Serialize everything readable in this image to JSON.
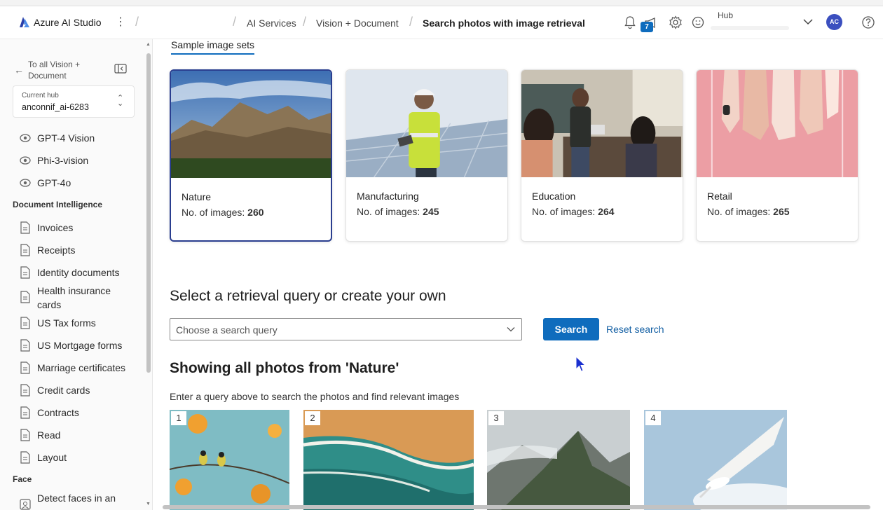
{
  "app": {
    "name": "Azure AI Studio"
  },
  "breadcrumb": [
    "AI Services",
    "Vision + Document",
    "Search photos with image retrieval"
  ],
  "header": {
    "notification_count": "7",
    "hub_label": "Hub",
    "avatar_initials": "AC"
  },
  "sidebar": {
    "back_label": "To all Vision + Document",
    "hub_card": {
      "label": "Current hub",
      "value": "anconnif_ai-6283"
    },
    "vision_items": [
      "GPT-4 Vision",
      "Phi-3-vision",
      "GPT-4o"
    ],
    "doc_section": "Document Intelligence",
    "doc_items": [
      "Invoices",
      "Receipts",
      "Identity documents",
      "Health insurance cards",
      "US Tax forms",
      "US Mortgage forms",
      "Marriage certificates",
      "Credit cards",
      "Contracts",
      "Read",
      "Layout"
    ],
    "face_section": "Face",
    "face_items": [
      "Detect faces in an"
    ]
  },
  "main": {
    "tab_label": "Sample image sets",
    "sets": [
      {
        "name": "Nature",
        "count_label": "No. of images:",
        "count": "260",
        "selected": true
      },
      {
        "name": "Manufacturing",
        "count_label": "No. of images:",
        "count": "245",
        "selected": false
      },
      {
        "name": "Education",
        "count_label": "No. of images:",
        "count": "264",
        "selected": false
      },
      {
        "name": "Retail",
        "count_label": "No. of images:",
        "count": "265",
        "selected": false
      }
    ],
    "query_heading": "Select a retrieval query or create your own",
    "query_placeholder": "Choose a search query",
    "search_label": "Search",
    "reset_label": "Reset search",
    "showing_heading": "Showing all photos from 'Nature'",
    "hint": "Enter a query above to search the photos and find relevant images",
    "photos": [
      "1",
      "2",
      "3",
      "4"
    ]
  },
  "colors": {
    "accent": "#0f6cbd",
    "selected_border": "#2a3e8f",
    "avatar": "#3b4fbf"
  }
}
